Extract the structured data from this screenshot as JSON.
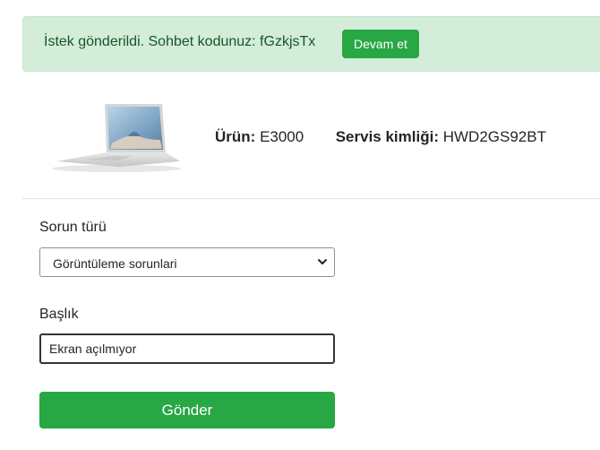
{
  "alert": {
    "message": "İstek gönderildi. Sohbet kodunuz: fGzkjsTx",
    "continue_label": "Devam et"
  },
  "product": {
    "model_label": "Ürün:",
    "model_value": "E3000",
    "service_id_label": "Servis kimliği:",
    "service_id_value": "HWD2GS92BT"
  },
  "form": {
    "issue_type_label": "Sorun türü",
    "issue_type_value": "Görüntüleme sorunlari",
    "title_label": "Başlık",
    "title_value": "Ekran açılmıyor",
    "submit_label": "Gönder"
  },
  "colors": {
    "success_bg": "#d4edda",
    "success_text": "#155724",
    "primary_button": "#28a745"
  },
  "icons": {
    "dropdown": "chevron-down-icon",
    "product": "laptop-image"
  }
}
